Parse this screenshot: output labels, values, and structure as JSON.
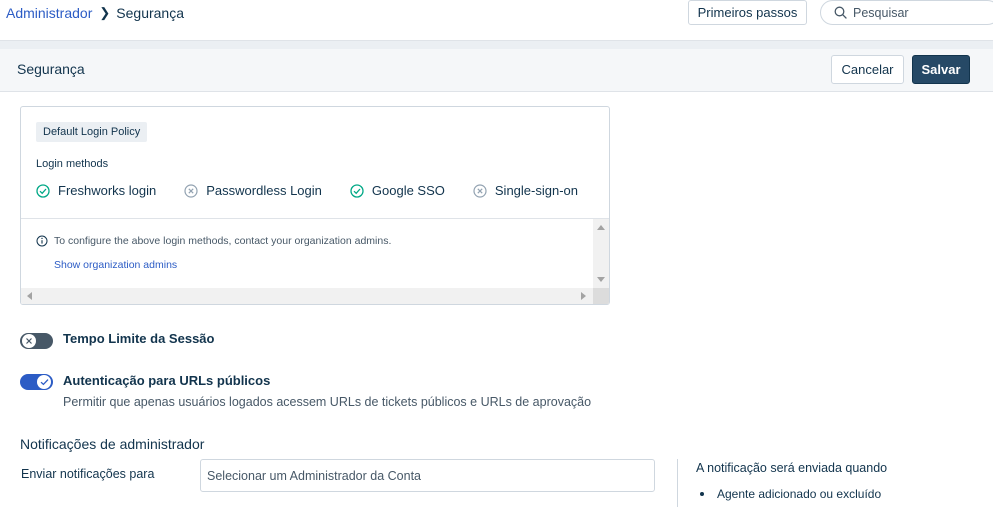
{
  "breadcrumb": {
    "parent": "Administrador",
    "current": "Segurança"
  },
  "topbar": {
    "first_steps_label": "Primeiros passos",
    "search_placeholder": "Pesquisar"
  },
  "page": {
    "title": "Segurança",
    "cancel_label": "Cancelar",
    "save_label": "Salvar"
  },
  "policy": {
    "tag": "Default Login Policy",
    "methods_label": "Login methods",
    "methods": [
      {
        "label": "Freshworks login",
        "enabled": true
      },
      {
        "label": "Passwordless Login",
        "enabled": false
      },
      {
        "label": "Google SSO",
        "enabled": true
      },
      {
        "label": "Single-sign-on",
        "enabled": false
      }
    ],
    "info_text": "To configure the above login methods, contact your organization admins.",
    "admins_link": "Show organization admins"
  },
  "session_timeout": {
    "label": "Tempo Limite da Sessão",
    "enabled": false
  },
  "public_urls": {
    "label": "Autenticação para URLs públicos",
    "description": "Permitir que apenas usuários logados acessem URLs de tickets públicos e URLs de aprovação",
    "enabled": true
  },
  "notifications": {
    "title": "Notificações de administrador",
    "send_to_label": "Enviar notificações para",
    "select_placeholder": "Selecionar um Administrador da Conta",
    "side_title": "A notificação será enviada quando",
    "side_items": [
      "Agente adicionado ou excluído"
    ]
  },
  "colors": {
    "primary": "#264966",
    "link": "#2c5cc5",
    "success": "#00a886",
    "muted": "#92a2b1"
  }
}
